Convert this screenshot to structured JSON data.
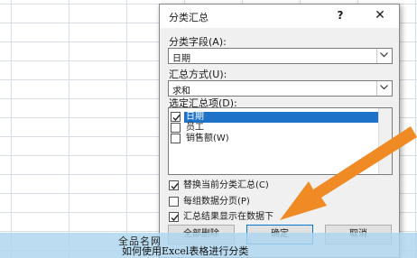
{
  "dialog": {
    "title": "分类汇总",
    "help_label": "?",
    "close_label": "✕",
    "group_by_label": "分类字段(A):",
    "group_by_value": "日期",
    "function_label": "汇总方式(U):",
    "function_value": "求和",
    "add_subtotal_label": "选定汇总项(D):",
    "fields": [
      {
        "label": "日期",
        "checked": true,
        "selected": true
      },
      {
        "label": "员工",
        "checked": false,
        "selected": false
      },
      {
        "label": "销售额(W)",
        "checked": false,
        "selected": false
      }
    ],
    "options": [
      {
        "label": "替换当前分类汇总(C)",
        "checked": true
      },
      {
        "label": "每组数据分页(P)",
        "checked": false
      },
      {
        "label": "汇总结果显示在数据下",
        "checked": true
      }
    ],
    "buttons": {
      "remove_all": "全部删除",
      "ok": "确定",
      "cancel": "取消"
    }
  },
  "caption": {
    "line1": "全品名网",
    "line2": "如何使用Excel表格进行分类"
  },
  "colors": {
    "selection": "#1e73c8",
    "arrow": "#f08a24",
    "caption_bg": "#add5ee"
  }
}
